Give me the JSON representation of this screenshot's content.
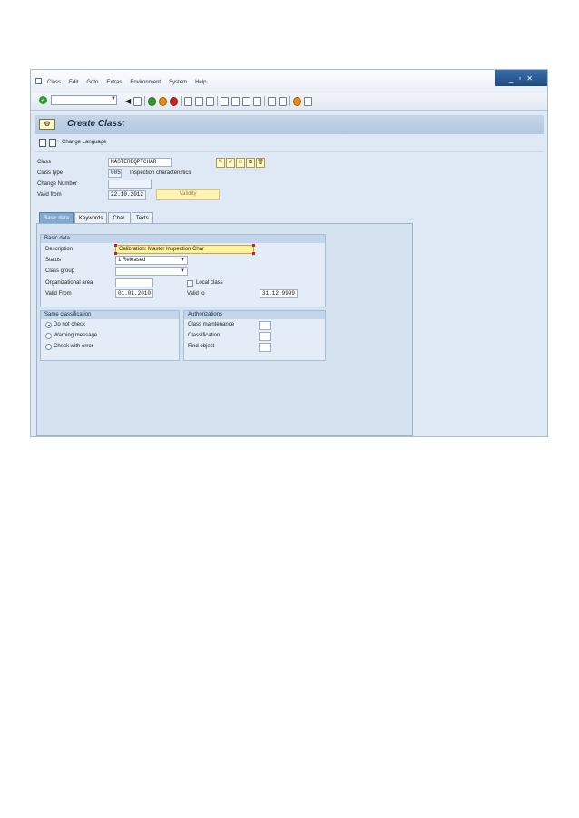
{
  "menu": {
    "items": [
      "Class",
      "Edit",
      "Goto",
      "Extras",
      "Environment",
      "System",
      "Help"
    ]
  },
  "window_controls": {
    "minimize": "_",
    "restore": "▫",
    "close": "✕"
  },
  "toolbar": {
    "command_value": ""
  },
  "title": {
    "text": "Create Class:"
  },
  "app_toolbar": {
    "change_language": "Change Language"
  },
  "header_fields": {
    "class_label": "Class",
    "class_value": "MASTEREQPTCHAR",
    "class_type_label": "Class type",
    "class_type_value": "005",
    "class_type_desc": "Inspection characteristics",
    "change_number_label": "Change Number",
    "change_number_value": "",
    "valid_from_label": "Valid from",
    "valid_from_value": "22.10.2012",
    "validity_button": "Validity"
  },
  "tabs": [
    {
      "label": "Basic data",
      "active": true
    },
    {
      "label": "Keywords",
      "active": false
    },
    {
      "label": "Char.",
      "active": false
    },
    {
      "label": "Texts",
      "active": false
    }
  ],
  "basic_data": {
    "group_title": "Basic data",
    "description_label": "Description",
    "description_value": "Calibration: Master Inspection Char",
    "status_label": "Status",
    "status_value": "1 Released",
    "class_group_label": "Class group",
    "class_group_value": "",
    "org_area_label": "Organizational area",
    "org_area_value": "",
    "local_class_label": "Local class",
    "local_class_checked": false,
    "valid_from_label": "Valid From",
    "valid_from_value": "01.01.2010",
    "valid_to_label": "Valid to",
    "valid_to_value": "31.12.9999"
  },
  "same_classification": {
    "group_title": "Same classification",
    "options": [
      {
        "label": "Do not check",
        "selected": true
      },
      {
        "label": "Warning message",
        "selected": false
      },
      {
        "label": "Check with error",
        "selected": false
      }
    ]
  },
  "authorizations": {
    "group_title": "Authorizations",
    "rows": [
      {
        "label": "Class maintenance",
        "value": ""
      },
      {
        "label": "Classification",
        "value": ""
      },
      {
        "label": "Find object",
        "value": ""
      }
    ]
  },
  "colors": {
    "accent": "#7fa9d1",
    "background": "#dfe9f5",
    "highlight": "#fff2a0"
  }
}
